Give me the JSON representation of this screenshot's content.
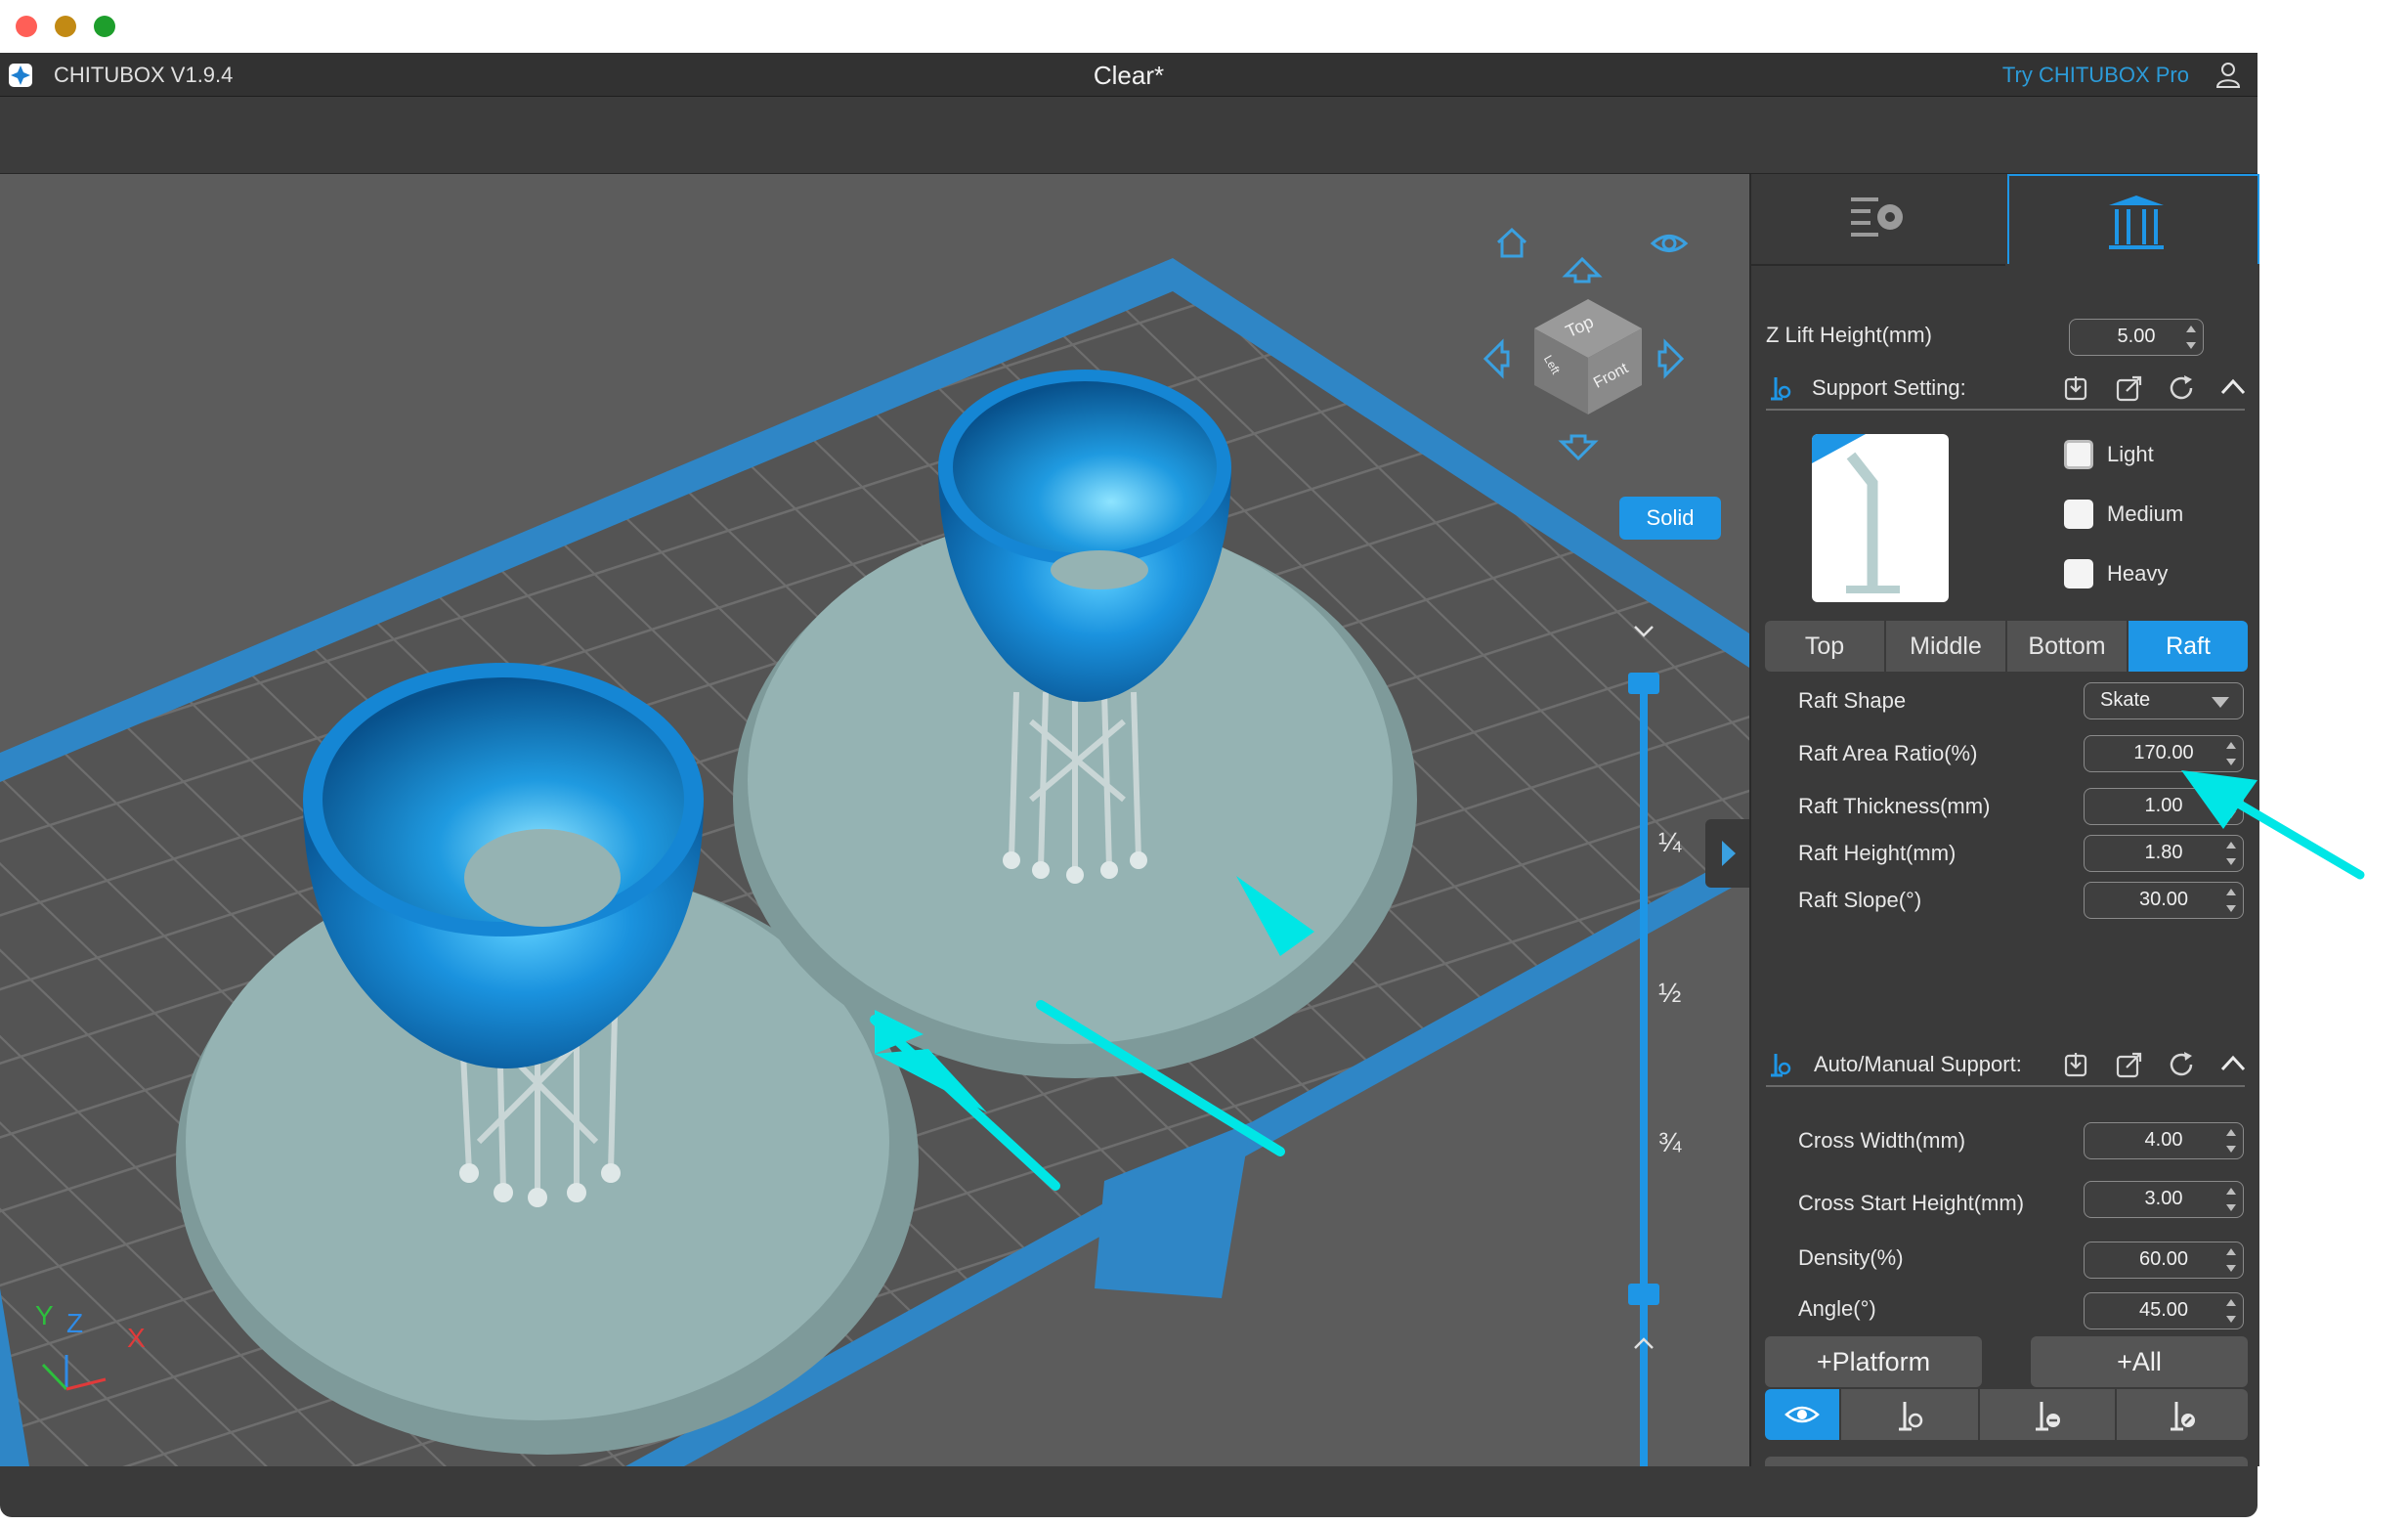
{
  "window": {
    "app_name": "CHITUBOX V1.9.4",
    "file_title": "Clear*",
    "promo_link": "Try CHITUBOX Pro"
  },
  "viewport": {
    "view_mode_button": "Solid",
    "view_cube": {
      "top_face": "Top",
      "front_face": "Front",
      "left_face": "Left"
    },
    "slider_marks": [
      "¼",
      "½",
      "¾"
    ],
    "axes": {
      "x": "X",
      "y": "Y",
      "z": "Z"
    }
  },
  "panel": {
    "z_lift": {
      "label": "Z Lift Height(mm)",
      "value": "5.00"
    },
    "support_setting": {
      "title": "Support Setting:",
      "presets": [
        {
          "label": "Light",
          "checked": false
        },
        {
          "label": "Medium",
          "checked": false
        },
        {
          "label": "Heavy",
          "checked": false
        }
      ]
    },
    "tabs": [
      {
        "label": "Top",
        "active": false
      },
      {
        "label": "Middle",
        "active": false
      },
      {
        "label": "Bottom",
        "active": false
      },
      {
        "label": "Raft",
        "active": true
      }
    ],
    "raft": {
      "shape_label": "Raft Shape",
      "shape_value": "Skate",
      "area_ratio": {
        "label": "Raft Area Ratio(%)",
        "value": "170.00"
      },
      "thickness": {
        "label": "Raft Thickness(mm)",
        "value": "1.00"
      },
      "height": {
        "label": "Raft Height(mm)",
        "value": "1.80"
      },
      "slope": {
        "label": "Raft Slope(°)",
        "value": "30.00"
      }
    },
    "auto_manual": {
      "title": "Auto/Manual Support:",
      "cross_width": {
        "label": "Cross Width(mm)",
        "value": "4.00"
      },
      "cross_start_height": {
        "label": "Cross Start Height(mm)",
        "value": "3.00"
      },
      "density": {
        "label": "Density(%)",
        "value": "60.00"
      },
      "angle": {
        "label": "Angle(°)",
        "value": "45.00"
      }
    },
    "buttons": {
      "platform": "+Platform",
      "all": "+All"
    }
  },
  "colors": {
    "accent": "#1e96e6",
    "model": "#1a8fd8",
    "raft": "#93b1b1",
    "annotation_arrow": "#00e5e5"
  }
}
